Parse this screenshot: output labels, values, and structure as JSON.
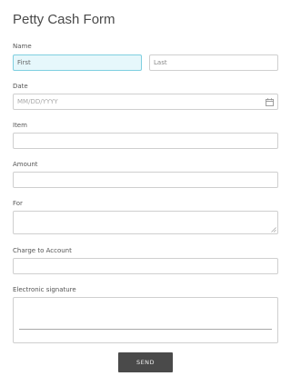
{
  "form": {
    "title": "Petty Cash Form",
    "name": {
      "label": "Name",
      "first_placeholder": "First",
      "last_placeholder": "Last"
    },
    "date": {
      "label": "Date",
      "placeholder": "MM/DD/YYYY",
      "icon": "calendar-icon"
    },
    "item": {
      "label": "Item",
      "value": ""
    },
    "amount": {
      "label": "Amount",
      "value": ""
    },
    "for": {
      "label": "For",
      "value": ""
    },
    "charge_to_account": {
      "label": "Charge to Account",
      "value": ""
    },
    "signature": {
      "label": "Electronic signature"
    },
    "send_label": "SEND"
  },
  "colors": {
    "focused_field_bg": "#e6f7fb",
    "focused_field_border": "#7fcfe0",
    "button_bg": "#4a4a4a"
  }
}
